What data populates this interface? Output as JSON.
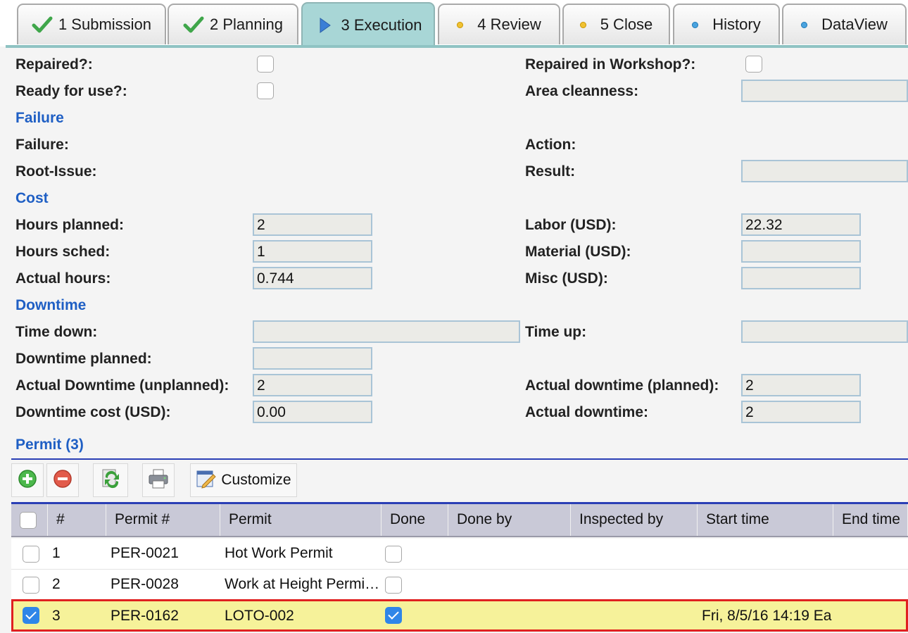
{
  "tabs": [
    {
      "label": "1 Submission",
      "icon": "check-icon"
    },
    {
      "label": "2 Planning",
      "icon": "check-icon"
    },
    {
      "label": "3 Execution",
      "icon": "play-icon"
    },
    {
      "label": "4 Review",
      "icon": "yellow-dot-icon"
    },
    {
      "label": "5 Close",
      "icon": "yellow-dot-icon"
    },
    {
      "label": "History",
      "icon": "blue-dot-icon"
    },
    {
      "label": "DataView",
      "icon": "blue-dot-icon"
    }
  ],
  "form": {
    "repaired": {
      "label": "Repaired?:",
      "checked": false
    },
    "repaired_workshop": {
      "label": "Repaired in Workshop?:",
      "checked": false
    },
    "ready": {
      "label": "Ready for use?:",
      "checked": false
    },
    "area": {
      "label": "Area cleanness:",
      "value": ""
    },
    "failure_section": "Failure",
    "failure": {
      "label": "Failure:"
    },
    "action": {
      "label": "Action:"
    },
    "root_issue": {
      "label": "Root-Issue:"
    },
    "result": {
      "label": "Result:",
      "value": ""
    },
    "cost_section": "Cost",
    "hours_planned": {
      "label": "Hours planned:",
      "value": "2"
    },
    "labor": {
      "label": "Labor (USD):",
      "value": "22.32"
    },
    "hours_sched": {
      "label": "Hours sched:",
      "value": "1"
    },
    "material": {
      "label": "Material (USD):",
      "value": ""
    },
    "actual_hours": {
      "label": "Actual hours:",
      "value": "0.744"
    },
    "misc": {
      "label": "Misc (USD):",
      "value": ""
    },
    "downtime_section": "Downtime",
    "time_down": {
      "label": "Time down:",
      "value": ""
    },
    "time_up": {
      "label": "Time up:",
      "value": ""
    },
    "downtime_planned": {
      "label": "Downtime planned:",
      "value": ""
    },
    "actual_downtime_unplanned": {
      "label": "Actual Downtime (unplanned):",
      "value": "2"
    },
    "actual_downtime_planned": {
      "label": "Actual downtime (planned):",
      "value": "2"
    },
    "downtime_cost": {
      "label": "Downtime cost (USD):",
      "value": "0.00"
    },
    "actual_downtime": {
      "label": "Actual downtime:",
      "value": "2"
    },
    "permit_section": "Permit (3)"
  },
  "toolbar": {
    "add_icon": "add-icon",
    "remove_icon": "remove-icon",
    "refresh_icon": "refresh-icon",
    "print_icon": "print-icon",
    "customize_label": "Customize"
  },
  "grid": {
    "headers": [
      "#",
      "Permit #",
      "Permit",
      "Done",
      "Done by",
      "Inspected by",
      "Start time",
      "End time"
    ],
    "rows": [
      {
        "num": "1",
        "permit_no": "PER-0021",
        "permit": "Hot Work Permit",
        "done": false,
        "done_by": "",
        "inspected_by": "",
        "start_time": "",
        "end_time": "",
        "selected": false
      },
      {
        "num": "2",
        "permit_no": "PER-0028",
        "permit": "Work at Height Permi…",
        "done": false,
        "done_by": "",
        "inspected_by": "",
        "start_time": "",
        "end_time": "",
        "selected": false
      },
      {
        "num": "3",
        "permit_no": "PER-0162",
        "permit": "LOTO-002",
        "done": true,
        "done_by": "",
        "inspected_by": "",
        "start_time": "Fri, 8/5/16 14:19 Ea",
        "end_time": "",
        "selected": true
      }
    ]
  },
  "colors": {
    "section": "#1f5fc4",
    "active_tab": "#a8d6d6",
    "selection_row": "#f6f29a",
    "selection_border": "#e02020",
    "accent_check": "#2f86e8"
  }
}
